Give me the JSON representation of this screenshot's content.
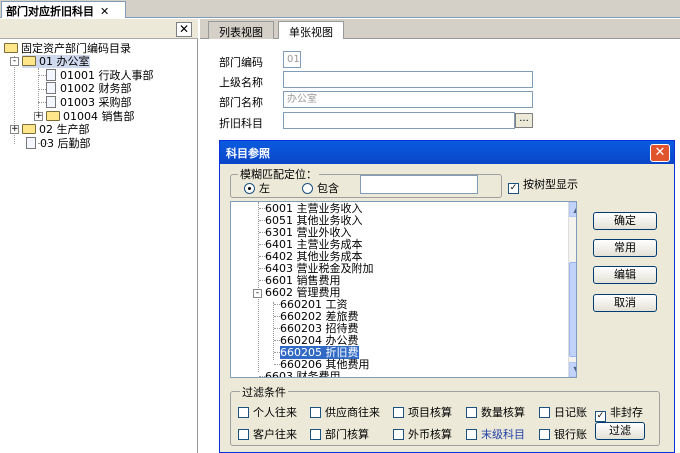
{
  "top_tab": {
    "title": "部门对应折旧科目",
    "close": "✕"
  },
  "left_panel": {
    "close": "✕",
    "tree": [
      {
        "label": "固定资产部门编码目录"
      },
      {
        "label": "01 办公室",
        "expander": "-"
      },
      {
        "label": "01001 行政人事部"
      },
      {
        "label": "01002 财务部"
      },
      {
        "label": "01003 采购部"
      },
      {
        "label": "01004 销售部",
        "expander": "+"
      },
      {
        "label": "02 生产部",
        "expander": "+"
      },
      {
        "label": "03 后勤部"
      }
    ]
  },
  "right_tabs": {
    "list_view": "列表视图",
    "single_view": "单张视图"
  },
  "form": {
    "dept_code_label": "部门编码",
    "dept_code_value": "01",
    "parent_name_label": "上级名称",
    "parent_name_value": "",
    "dept_name_label": "部门名称",
    "dept_name_value": "办公室",
    "depr_account_label": "折旧科目",
    "depr_account_value": "",
    "browse_button": "..."
  },
  "dialog": {
    "title": "科目参照",
    "close": "✕",
    "fuzzy_group": "模糊匹配定位：",
    "radio_left": "左",
    "radio_contains": "包含",
    "search_value": "",
    "tree_display_label": "按树型显示",
    "tree_display_checked": true,
    "accounts": [
      {
        "label": "6001 主营业务收入"
      },
      {
        "label": "6051 其他业务收入"
      },
      {
        "label": "6301 营业外收入"
      },
      {
        "label": "6401 主营业务成本"
      },
      {
        "label": "6402 其他业务成本"
      },
      {
        "label": "6403 营业税金及附加"
      },
      {
        "label": "6601 销售费用"
      },
      {
        "label": "6602 管理费用",
        "expander": "-"
      },
      {
        "label": "660201 工资"
      },
      {
        "label": "660202 差旅费"
      },
      {
        "label": "660203 招待费"
      },
      {
        "label": "660204 办公费"
      },
      {
        "label": "660205 折旧费",
        "selected": true
      },
      {
        "label": "660206 其他费用"
      },
      {
        "label": "6603 财务费用"
      }
    ],
    "buttons": {
      "ok": "确定",
      "common": "常用",
      "edit": "编辑",
      "cancel": "取消",
      "filter": "过滤"
    },
    "filter_group": "过滤条件",
    "filters": [
      {
        "label": "个人往来",
        "checked": false
      },
      {
        "label": "供应商往来",
        "checked": false
      },
      {
        "label": "项目核算",
        "checked": false
      },
      {
        "label": "数量核算",
        "checked": false
      },
      {
        "label": "日记账",
        "checked": false
      },
      {
        "label": "非封存",
        "checked": true
      },
      {
        "label": "客户往来",
        "checked": false
      },
      {
        "label": "部门核算",
        "checked": false
      },
      {
        "label": "外币核算",
        "checked": false
      },
      {
        "label": "末级科目",
        "checked": false
      },
      {
        "label": "银行账",
        "checked": false
      }
    ],
    "colors": {
      "title_bar": "#0a52d8",
      "selected_row": "#316ac5",
      "last_level_text": "#1f3fa8"
    }
  }
}
